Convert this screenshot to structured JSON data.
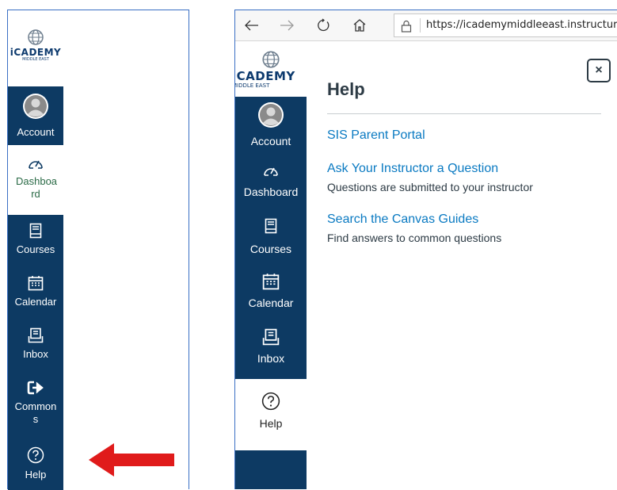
{
  "left_nav": {
    "logo": {
      "brand": "iCADEMY",
      "sub": "MIDDLE EAST"
    },
    "items": [
      {
        "label": "Account"
      },
      {
        "label": "Dashboa rd"
      },
      {
        "label": "Courses"
      },
      {
        "label": "Calendar"
      },
      {
        "label": "Inbox"
      },
      {
        "label": "Common s"
      },
      {
        "label": "Help"
      }
    ]
  },
  "browser": {
    "url": "https://icademymiddleeast.instructure.com"
  },
  "right_nav": {
    "logo": {
      "brand": "iCADEMY",
      "sub": "MIDDLE EAST"
    },
    "items": [
      {
        "label": "Account"
      },
      {
        "label": "Dashboard"
      },
      {
        "label": "Courses"
      },
      {
        "label": "Calendar"
      },
      {
        "label": "Inbox"
      },
      {
        "label": "Help"
      }
    ]
  },
  "help_tray": {
    "title": "Help",
    "close_icon": "×",
    "links": [
      {
        "label": "SIS Parent Portal",
        "description": ""
      },
      {
        "label": "Ask Your Instructor a Question",
        "description": "Questions are submitted to your instructor"
      },
      {
        "label": "Search the Canvas Guides",
        "description": "Find answers to common questions"
      }
    ]
  },
  "colors": {
    "nav_bg": "#0d3a63",
    "link": "#0a7ac2",
    "arrow": "#e01b1b",
    "panel_border": "#3a6fc4"
  }
}
